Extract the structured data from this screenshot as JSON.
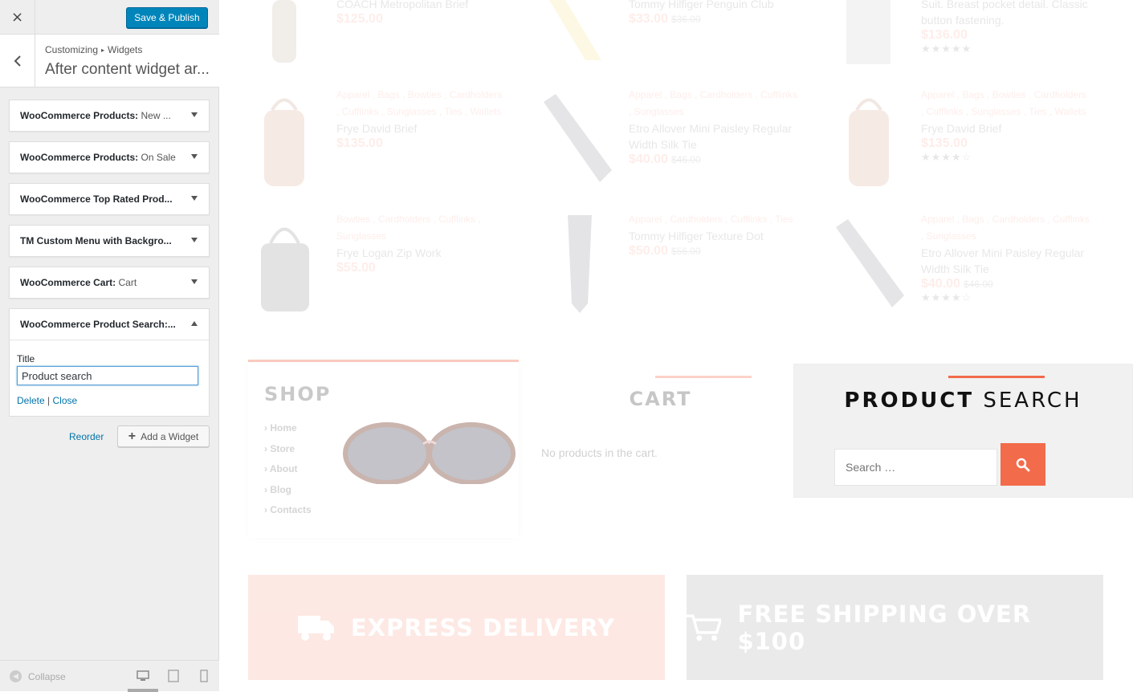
{
  "customizer": {
    "close_icon": "×",
    "publish_label": "Save & Publish",
    "breadcrumb": {
      "parent": "Customizing",
      "separator": "▸",
      "current": "Widgets"
    },
    "section_title": "After content widget ar...",
    "widgets": [
      {
        "name": "WooCommerce Products:",
        "sub": "New ...",
        "open": false
      },
      {
        "name": "WooCommerce Products:",
        "sub": "On Sale",
        "open": false
      },
      {
        "name": "WooCommerce Top Rated Prod...",
        "sub": "",
        "open": false
      },
      {
        "name": "TM Custom Menu with Backgro...",
        "sub": "",
        "open": false
      },
      {
        "name": "WooCommerce Cart:",
        "sub": "Cart",
        "open": false
      },
      {
        "name": "WooCommerce Product Search:...",
        "sub": "",
        "open": true
      }
    ],
    "widget_form": {
      "title_label": "Title",
      "title_value": "Product search",
      "delete_label": "Delete",
      "separator": "|",
      "close_label": "Close"
    },
    "reorder_label": "Reorder",
    "add_widget_label": "Add a Widget",
    "collapse_label": "Collapse"
  },
  "preview": {
    "products": [
      {
        "cats": "",
        "name": "COACH Metropolitan Brief",
        "price": "$125.00",
        "old": "",
        "stars": ""
      },
      {
        "cats": "",
        "name": "Tommy Hilfiger Penguin Club",
        "price": "$33.00",
        "old": "$36.00",
        "stars": ""
      },
      {
        "cats": "",
        "name": "Suit. Breast pocket detail. Classic button fastening.",
        "price": "$136.00",
        "old": "",
        "stars": "★★★★★"
      },
      {
        "cats": "Apparel , Bags , Bowties , Cardholders , Cufflinks , Sunglasses , Ties , Wallets",
        "name": "Frye David Brief",
        "price": "$135.00",
        "old": "",
        "stars": ""
      },
      {
        "cats": "Apparel , Bags , Cardholders , Cufflinks , Sunglasses",
        "name": "Etro Allover Mini Paisley Regular Width Silk Tie",
        "price": "$40.00",
        "old": "$46.00",
        "stars": ""
      },
      {
        "cats": "Apparel , Bags , Bowties , Cardholders , Cufflinks , Sunglasses , Ties , Wallets",
        "name": "Frye David Brief",
        "price": "$135.00",
        "old": "",
        "stars": "★★★★☆"
      },
      {
        "cats": "Bowties , Cardholders , Cufflinks , Sunglasses",
        "name": "Frye Logan Zip Work",
        "price": "$55.00",
        "old": "",
        "stars": ""
      },
      {
        "cats": "Apparel , Cardholders , Cufflinks , Ties",
        "name": "Tommy Hilfiger Texture Dot",
        "price": "$50.00",
        "old": "$56.00",
        "stars": ""
      },
      {
        "cats": "Apparel , Bags , Cardholders , Cufflinks , Sunglasses",
        "name": "Etro Allover Mini Paisley Regular Width Silk Tie",
        "price": "$40.00",
        "old": "$46.00",
        "stars": "★★★★☆"
      }
    ],
    "shop": {
      "title": "SHOP",
      "menu": [
        "Home",
        "Store",
        "About",
        "Blog",
        "Contacts"
      ]
    },
    "cart": {
      "title": "CART",
      "empty_text": "No products in the cart."
    },
    "product_search": {
      "title_bold": "PRODUCT",
      "title_light": "SEARCH",
      "placeholder": "Search …"
    },
    "banners": [
      {
        "text": "EXPRESS DELIVERY",
        "icon": "truck-icon"
      },
      {
        "text": "FREE SHIPPING OVER $100",
        "icon": "cart-icon"
      }
    ]
  },
  "colors": {
    "accent": "#f26b4b",
    "wp_blue": "#0085ba",
    "link": "#0073aa"
  }
}
